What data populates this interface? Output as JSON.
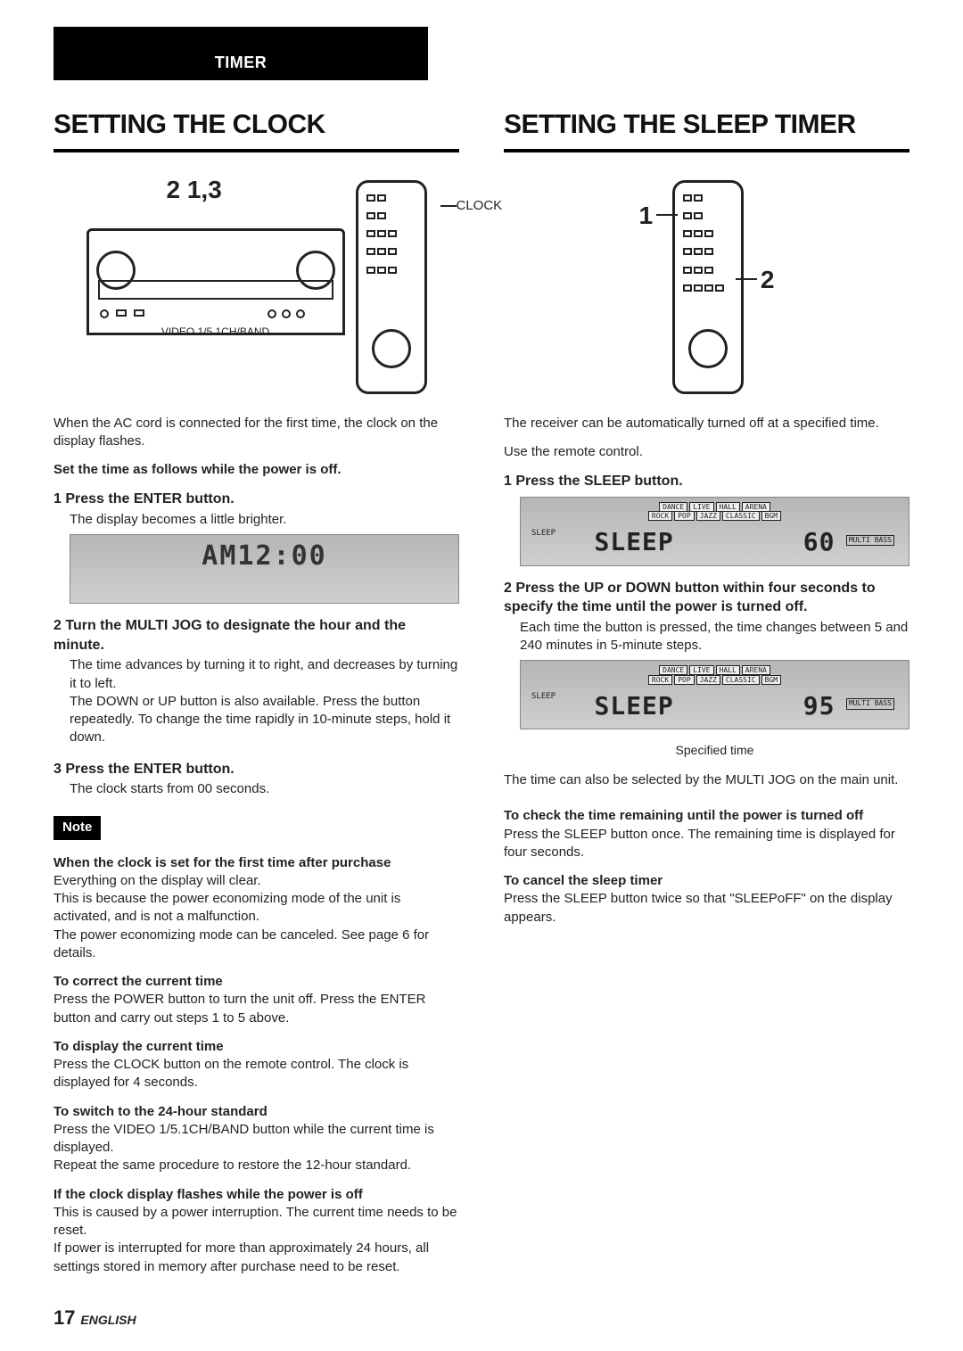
{
  "header": {
    "tab": "TIMER"
  },
  "clock": {
    "title": "SETTING THE CLOCK",
    "diag": {
      "nums": "2 1,3",
      "remote_label": "CLOCK",
      "receiver_label": "VIDEO 1/5.1CH/BAND"
    },
    "intro1": "When the AC cord is connected for the first time, the clock on the display flashes.",
    "intro2": "Set the time as follows while the power is off.",
    "steps": [
      {
        "n": "1",
        "t": "Press the ENTER button.",
        "b": "The display becomes a little brighter."
      },
      {
        "n": "2",
        "t": "Turn the MULTI JOG to designate the hour and the minute.",
        "b": "The time advances by turning it to right, and decreases by turning it to left.\nThe DOWN or UP button is also available. Press the button repeatedly. To change the time rapidly in 10-minute steps, hold it down."
      },
      {
        "n": "3",
        "t": "Press the ENTER button.",
        "b": "The clock starts from 00 seconds."
      }
    ],
    "lcd1": "AM12:00",
    "note_label": "Note",
    "notes": [
      {
        "h": "When the clock is set for the first time after purchase",
        "p": "Everything on the display will clear.\nThis is because the power economizing mode of the unit is activated, and is not a malfunction.\nThe power economizing mode can be canceled. See page 6 for details."
      },
      {
        "h": "To correct the current time",
        "p": "Press the POWER button to turn the unit off. Press the ENTER button and carry out steps 1 to 5 above."
      },
      {
        "h": "To display the current time",
        "p": "Press the CLOCK button on the remote control. The clock is displayed for 4 seconds."
      },
      {
        "h": "To switch to the 24-hour standard",
        "p": "Press the VIDEO 1/5.1CH/BAND button while the current time is displayed.\nRepeat the same procedure to restore the 12-hour standard."
      },
      {
        "h": "If the clock display flashes while the power is off",
        "p": "This is caused by a power interruption. The current time needs to be reset.\nIf power is interrupted for more than approximately 24 hours, all settings stored in memory after purchase need to be reset."
      }
    ]
  },
  "sleep": {
    "title": "SETTING THE SLEEP TIMER",
    "diag": {
      "n1": "1",
      "n2": "2"
    },
    "intro1": "The receiver can be automatically turned off at a specified time.",
    "intro2": "Use the remote control.",
    "steps": [
      {
        "n": "1",
        "t": "Press the SLEEP button.",
        "b": ""
      },
      {
        "n": "2",
        "t": "Press the UP or DOWN button within four seconds to specify the time until the power is turned off.",
        "b": "Each time the button is pressed, the time changes between 5 and 240 minutes in 5-minute steps."
      }
    ],
    "lcd_modes": [
      "DANCE",
      "LIVE",
      "HALL",
      "ARENA",
      "ROCK",
      "POP",
      "JAZZ",
      "CLASSIC",
      "BGM"
    ],
    "lcd_sleep_lbl": "SLEEP",
    "lcd_bbe": "MULTI BASS",
    "lcd1_txt1": "SLEEP",
    "lcd1_txt2": "60",
    "lcd2_txt1": "SLEEP",
    "lcd2_txt2": "95",
    "caption": "Specified time",
    "post1": "The time can also be selected by the MULTI JOG on the main unit.",
    "notes": [
      {
        "h": "To check the time remaining until the power is turned off",
        "p": "Press the SLEEP button once. The remaining time is displayed for four seconds."
      },
      {
        "h": "To cancel the sleep timer",
        "p": "Press the SLEEP button twice so that \"SLEEPoFF\" on the display appears."
      }
    ]
  },
  "footer": {
    "page": "17",
    "lang": "ENGLISH"
  }
}
